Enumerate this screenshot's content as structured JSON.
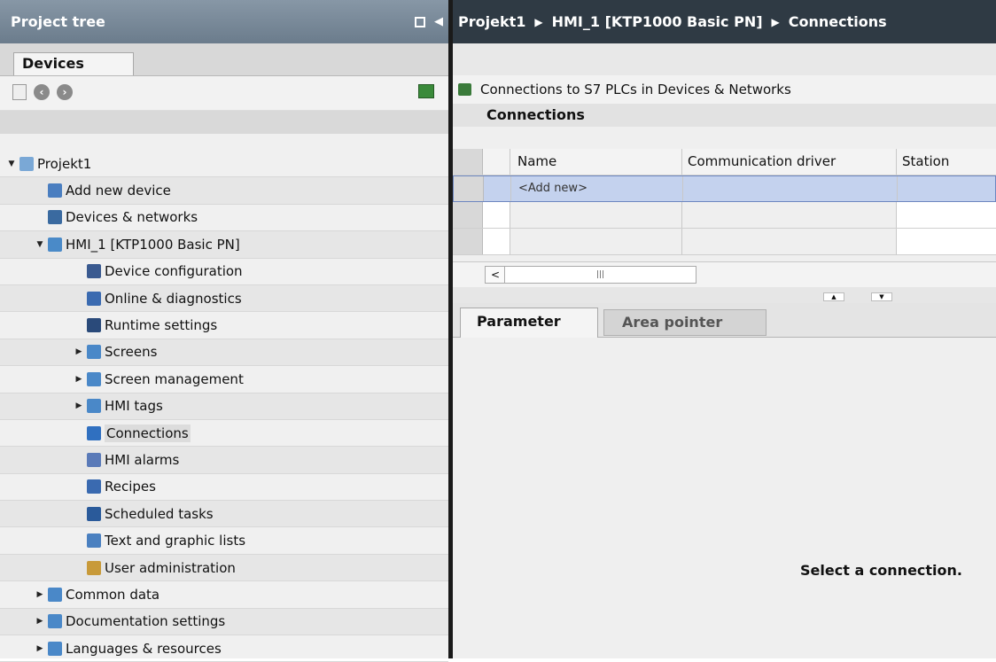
{
  "left_panel": {
    "title": "Project tree",
    "tab": "Devices"
  },
  "tree": [
    {
      "label": "Projekt1",
      "indent": 0,
      "expander": "▼",
      "icon": "project-icon",
      "color": "#7aa8d6"
    },
    {
      "label": "Add new device",
      "indent": 1,
      "expander": "",
      "icon": "add-device-icon",
      "color": "#4a7ec0"
    },
    {
      "label": "Devices & networks",
      "indent": 1,
      "expander": "",
      "icon": "network-icon",
      "color": "#3a6aa0"
    },
    {
      "label": "HMI_1 [KTP1000 Basic PN]",
      "indent": 1,
      "expander": "▼",
      "icon": "hmi-device-icon",
      "color": "#4a8ac8"
    },
    {
      "label": "Device configuration",
      "indent": 2,
      "expander": "",
      "icon": "device-configuration-icon",
      "color": "#3a5a90"
    },
    {
      "label": "Online & diagnostics",
      "indent": 2,
      "expander": "",
      "icon": "diagnostics-icon",
      "color": "#3a6ab0"
    },
    {
      "label": "Runtime settings",
      "indent": 2,
      "expander": "",
      "icon": "runtime-settings-icon",
      "color": "#2a4a7a"
    },
    {
      "label": "Screens",
      "indent": 2,
      "expander": "▶",
      "icon": "folder-icon",
      "color": "#4a88c8"
    },
    {
      "label": "Screen management",
      "indent": 2,
      "expander": "▶",
      "icon": "folder-icon",
      "color": "#4a88c8"
    },
    {
      "label": "HMI tags",
      "indent": 2,
      "expander": "▶",
      "icon": "folder-icon",
      "color": "#4a88c8"
    },
    {
      "label": "Connections",
      "indent": 2,
      "expander": "",
      "icon": "connections-icon",
      "color": "#3070c0",
      "selected": true
    },
    {
      "label": "HMI alarms",
      "indent": 2,
      "expander": "",
      "icon": "mail-icon",
      "color": "#5a7ab8"
    },
    {
      "label": "Recipes",
      "indent": 2,
      "expander": "",
      "icon": "recipes-icon",
      "color": "#3a6ab0"
    },
    {
      "label": "Scheduled tasks",
      "indent": 2,
      "expander": "",
      "icon": "calendar-icon",
      "color": "#2a5a9a"
    },
    {
      "label": "Text and graphic lists",
      "indent": 2,
      "expander": "",
      "icon": "list-icon",
      "color": "#4a80c0"
    },
    {
      "label": "User administration",
      "indent": 2,
      "expander": "",
      "icon": "user-icon",
      "color": "#c89a3a"
    },
    {
      "label": "Common data",
      "indent": 1,
      "expander": "▶",
      "icon": "folder-icon",
      "color": "#4a88c8"
    },
    {
      "label": "Documentation settings",
      "indent": 1,
      "expander": "▶",
      "icon": "folder-icon",
      "color": "#4a88c8"
    },
    {
      "label": "Languages & resources",
      "indent": 1,
      "expander": "▶",
      "icon": "folder-icon",
      "color": "#4a88c8"
    }
  ],
  "breadcrumb": [
    "Projekt1",
    "HMI_1 [KTP1000 Basic PN]",
    "Connections"
  ],
  "connections": {
    "link_text": "Connections to S7 PLCs in Devices & Networks",
    "section_title": "Connections",
    "columns": [
      "Name",
      "Communication driver",
      "Station"
    ],
    "add_new": "<Add new>"
  },
  "inspector": {
    "tabs": [
      "Parameter",
      "Area pointer"
    ],
    "message": "Select a connection."
  }
}
